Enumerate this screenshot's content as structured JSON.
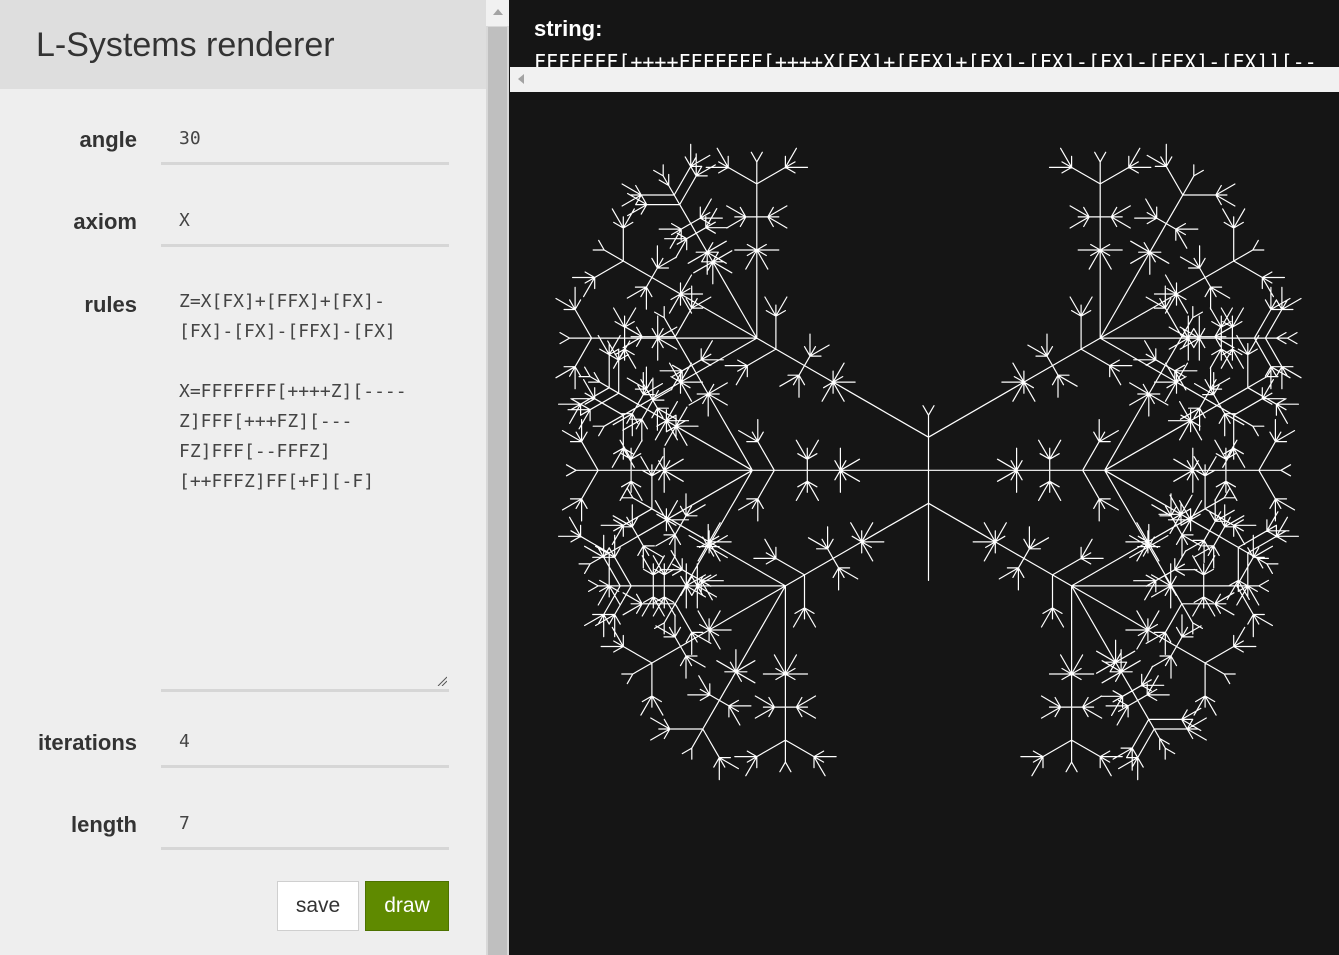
{
  "app": {
    "title": "L-Systems renderer"
  },
  "fields": {
    "angle": {
      "label": "angle",
      "value": "30"
    },
    "axiom": {
      "label": "axiom",
      "value": "X"
    },
    "rules": {
      "label": "rules",
      "value": "Z=X[FX]+[FFX]+[FX]-[FX]-[FX]-[FFX]-[FX]\n\nX=FFFFFFF[++++Z][----Z]FFF[+++FZ][---FZ]FFF[--FFFZ][++FFFZ]FF[+F][-F]"
    },
    "iterations": {
      "label": "iterations",
      "value": "4"
    },
    "length": {
      "label": "length",
      "value": "7"
    }
  },
  "buttons": {
    "save": "save",
    "draw": "draw"
  },
  "output": {
    "string_label": "string:",
    "string_value": "FFFFFFF[++++FFFFFFF[++++X[FX]+[FFX]+[FX]-[FX]-[FX]-[FFX]-[FX]][--"
  },
  "colors": {
    "draw_button": "#5f8a00",
    "canvas_bg": "#151515",
    "stroke": "#ffffff"
  }
}
